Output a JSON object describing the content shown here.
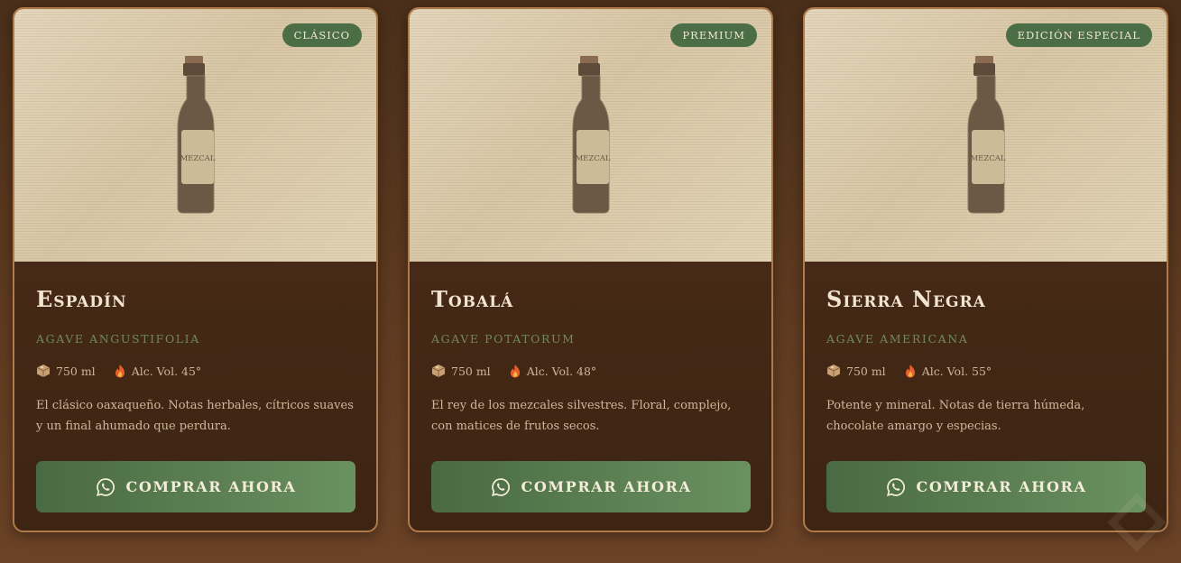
{
  "colors": {
    "accent": "#4c6e47",
    "card_border": "#b07a4a",
    "title": "#f1e5cf",
    "species": "#6e8a5c",
    "text": "#cdb89b"
  },
  "cards": [
    {
      "badge": "CLÁSICO",
      "bottle_label": "MEZCAL",
      "name": "Espadín",
      "species": "AGAVE ANGUSTIFOLIA",
      "volume": "750 ml",
      "alcohol": "Alc. Vol. 45°",
      "description": "El clásico oaxaqueño. Notas herbales, cítricos suaves y un final ahumado que perdura.",
      "button": "COMPRAR AHORA",
      "icons": [
        "box-icon",
        "fire-icon",
        "whatsapp-icon"
      ]
    },
    {
      "badge": "PREMIUM",
      "bottle_label": "MEZCAL",
      "name": "Tobalá",
      "species": "AGAVE POTATORUM",
      "volume": "750 ml",
      "alcohol": "Alc. Vol. 48°",
      "description": "El rey de los mezcales silvestres. Floral, complejo, con matices de frutos secos.",
      "button": "COMPRAR AHORA",
      "icons": [
        "box-icon",
        "fire-icon",
        "whatsapp-icon"
      ]
    },
    {
      "badge": "EDICIÓN ESPECIAL",
      "bottle_label": "MEZCAL",
      "name": "Sierra Negra",
      "species": "AGAVE AMERICANA",
      "volume": "750 ml",
      "alcohol": "Alc. Vol. 55°",
      "description": "Potente y mineral. Notas de tierra húmeda, chocolate amargo y especias.",
      "button": "COMPRAR AHORA",
      "icons": [
        "box-icon",
        "fire-icon",
        "whatsapp-icon"
      ]
    }
  ]
}
